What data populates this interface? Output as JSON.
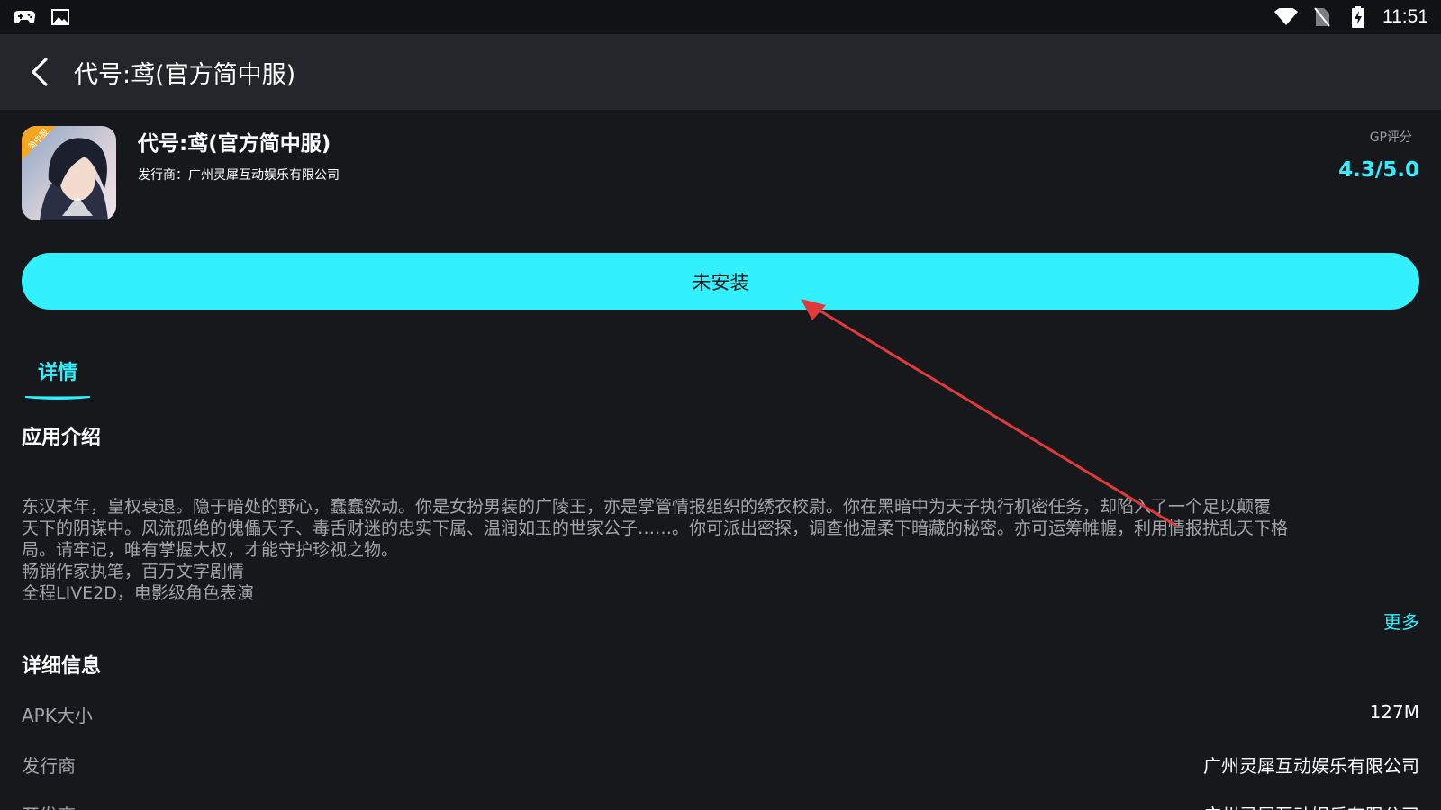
{
  "status_bar": {
    "left_icons": [
      "gamepad-icon",
      "image-icon"
    ],
    "right_icons": [
      "wifi-icon",
      "no-sim-icon",
      "battery-charging-icon"
    ],
    "time": "11:51"
  },
  "app_bar": {
    "title": "代号:鸢(官方简中服)"
  },
  "app": {
    "name": "代号:鸢(官方简中服)",
    "publisher_line": "发行商：广州灵犀互动娱乐有限公司",
    "icon_badge": "简中服",
    "rating_label": "GP评分",
    "rating_value": "4.3/5.0"
  },
  "install_button": {
    "label": "未安装"
  },
  "tabs": [
    {
      "label": "详情",
      "active": true
    }
  ],
  "intro": {
    "title": "应用介绍",
    "lines": [
      "东汉末年，皇权衰退。隐于暗处的野心，蠢蠢欲动。你是女扮男装的广陵王，亦是掌管情报组织的绣衣校尉。你在黑暗中为天子执行机密任务，却陷入了一个足以颠覆",
      "天下的阴谋中。风流孤绝的傀儡天子、毒舌财迷的忠实下属、温润如玉的世家公子……。你可派出密探，调查他温柔下暗藏的秘密。亦可运筹帷幄，利用情报扰乱天下格",
      "局。请牢记，唯有掌握大权，才能守护珍视之物。",
      "畅销作家执笔，百万文字剧情",
      "全程LIVE2D，电影级角色表演"
    ],
    "more_label": "更多"
  },
  "details": {
    "title": "详细信息",
    "rows": [
      {
        "key": "APK大小",
        "value": "127M"
      },
      {
        "key": "发行商",
        "value": "广州灵犀互动娱乐有限公司"
      },
      {
        "key": "开发商",
        "value": "广州灵犀互动娱乐有限公司"
      }
    ]
  },
  "colors": {
    "accent": "#33eefc",
    "background": "#17181c",
    "app_bar": "#24262b",
    "annotation_arrow": "#e03a3a"
  }
}
